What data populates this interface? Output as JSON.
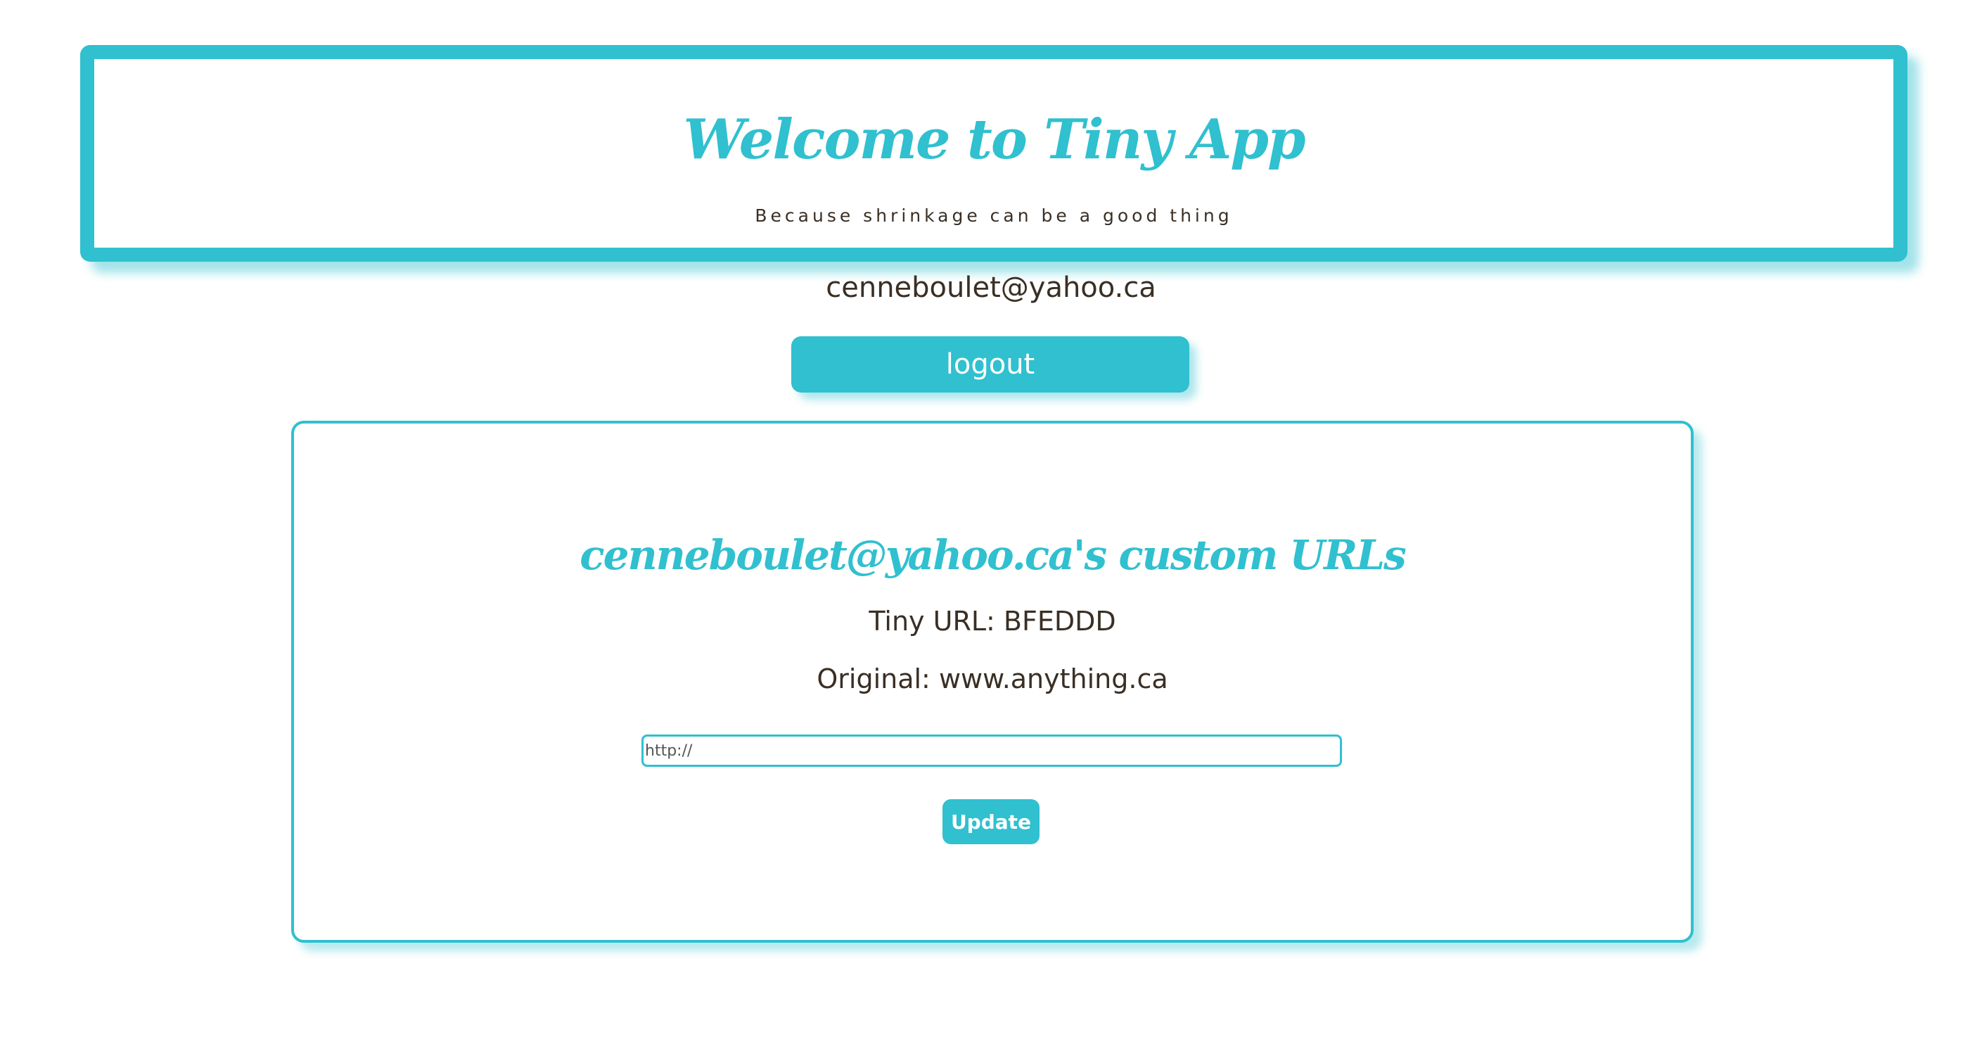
{
  "header": {
    "title": "Welcome to Tiny App",
    "subtitle": "Because shrinkage can be a good thing"
  },
  "user": {
    "email": "cenneboulet@yahoo.ca"
  },
  "actions": {
    "logout_label": "logout"
  },
  "urls_panel": {
    "title": "cenneboulet@yahoo.ca's custom URLs",
    "tiny_url_line": "Tiny URL: BFEDDD",
    "original_line": "Original: www.anything.ca",
    "input_placeholder": "http://",
    "update_label": "Update"
  },
  "colors": {
    "accent": "#30c0cf",
    "text": "#3a2f25",
    "background": "#ffffff"
  }
}
